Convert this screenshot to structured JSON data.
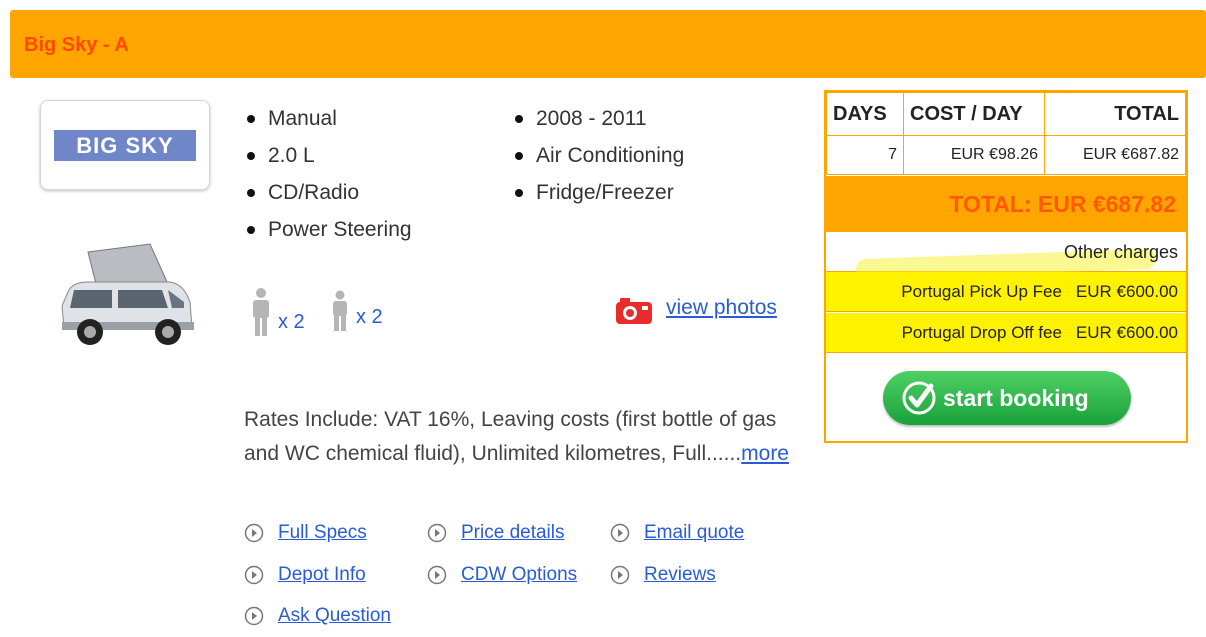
{
  "header": {
    "title": "Big Sky - A"
  },
  "logo": {
    "text": "BIG SKY"
  },
  "specs": {
    "left": [
      "Manual",
      "2.0 L",
      "CD/Radio",
      "Power Steering"
    ],
    "right": [
      "2008 - 2011",
      "Air Conditioning",
      "Fridge/Freezer"
    ]
  },
  "capacity": {
    "adults": "x 2",
    "children": "x 2"
  },
  "photos": {
    "label": "view photos"
  },
  "rates": {
    "text": "Rates Include: VAT 16%, Leaving costs (first bottle of gas and WC chemical fluid), Unlimited kilometres, Full......",
    "more": "more"
  },
  "links": [
    "Full Specs",
    "Price details",
    "Email quote",
    "Depot Info",
    "CDW Options",
    "Reviews",
    "Ask Question"
  ],
  "pricing": {
    "headers": [
      "DAYS",
      "COST / DAY",
      "TOTAL"
    ],
    "row": [
      "7",
      "EUR €98.26",
      "EUR €687.82"
    ],
    "total": "TOTAL: EUR €687.82",
    "other_charges": "Other charges",
    "fees": [
      {
        "name": "Portugal Pick Up Fee",
        "amount": "EUR €600.00"
      },
      {
        "name": "Portugal Drop Off fee",
        "amount": "EUR €600.00"
      }
    ]
  },
  "booking": {
    "label": "start booking"
  },
  "colors": {
    "accent": "#ffa500",
    "title": "#ff4a00",
    "link": "#2a5bd7",
    "highlight": "#fff200",
    "button": "#19a23a"
  }
}
